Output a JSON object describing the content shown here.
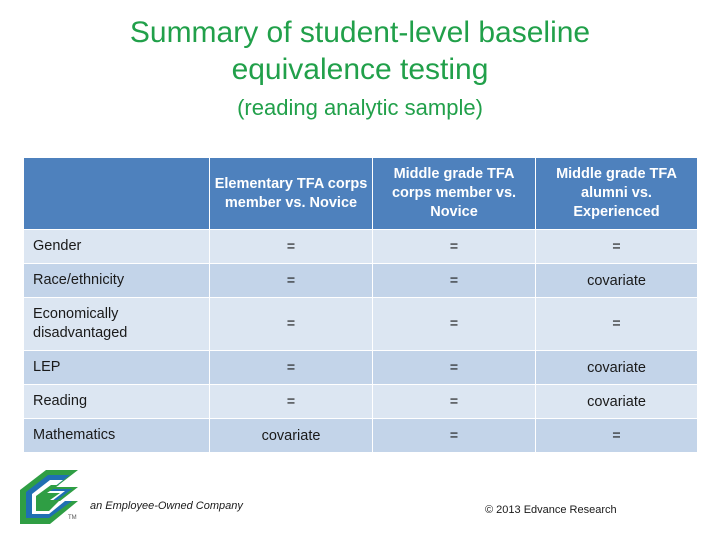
{
  "slide": {
    "title_line_1": "Summary of student-level baseline",
    "title_line_2": "equivalence testing",
    "subtitle": "(reading analytic sample)",
    "title_color": "#21A04A"
  },
  "table": {
    "header_fill": "#4E81BD",
    "row_fill_light": "#DCE6F2",
    "row_fill_dark": "#C3D4E9",
    "corner_label": "",
    "columns": [
      "Elementary TFA corps member vs. Novice",
      "Middle grade TFA corps member vs. Novice",
      "Middle grade TFA alumni vs. Experienced"
    ],
    "rows": [
      {
        "label": "Gender",
        "values": [
          "=",
          "=",
          "="
        ]
      },
      {
        "label": "Race/ethnicity",
        "values": [
          "=",
          "=",
          "covariate"
        ]
      },
      {
        "label": "Economically disadvantaged",
        "values": [
          "=",
          "=",
          "="
        ]
      },
      {
        "label": "LEP",
        "values": [
          "=",
          "=",
          "covariate"
        ]
      },
      {
        "label": "Reading",
        "values": [
          "=",
          "=",
          "covariate"
        ]
      },
      {
        "label": "Mathematics",
        "values": [
          "covariate",
          "=",
          "="
        ]
      }
    ]
  },
  "footer": {
    "employee_owned": "an Employee-Owned Company",
    "copyright": "© 2013 Edvance Research",
    "logo_tm": "TM"
  }
}
